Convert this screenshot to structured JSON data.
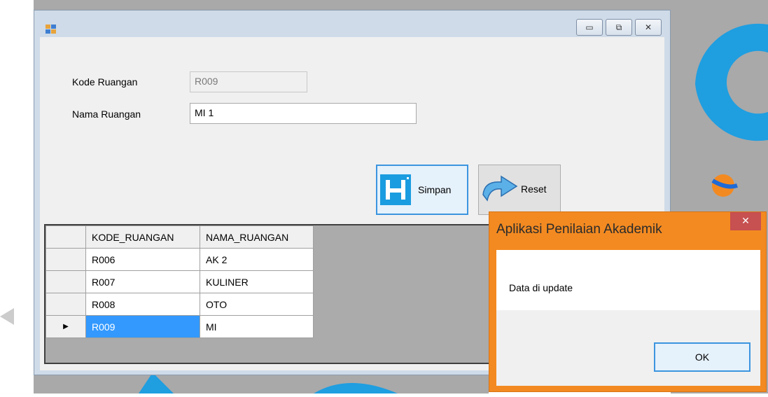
{
  "window": {
    "controls": {
      "minimize": "▭",
      "maximize": "⧉",
      "close": "✕"
    }
  },
  "form": {
    "kode_label": "Kode Ruangan",
    "kode_value": "R009",
    "nama_label": "Nama Ruangan",
    "nama_value": "MI 1",
    "simpan_label": "Simpan",
    "reset_label": "Reset"
  },
  "grid": {
    "columns": [
      "KODE_RUANGAN",
      "NAMA_RUANGAN"
    ],
    "rows": [
      {
        "kode": "R006",
        "nama": "AK 2"
      },
      {
        "kode": "R007",
        "nama": "KULINER"
      },
      {
        "kode": "R008",
        "nama": "OTO"
      },
      {
        "kode": "R009",
        "nama": "MI",
        "current": "▶"
      }
    ]
  },
  "dialog": {
    "title": "Aplikasi Penilaian Akademik",
    "close": "✕",
    "message": "Data di update",
    "ok_label": "OK"
  },
  "colors": {
    "accent_blue": "#3399ff",
    "dialog_frame": "#f38a21",
    "save_icon": "#1a9ce0"
  },
  "icons": {
    "app": "windows-form-icon",
    "save": "floppy-disk-icon",
    "reset": "undo-arrow-icon"
  }
}
